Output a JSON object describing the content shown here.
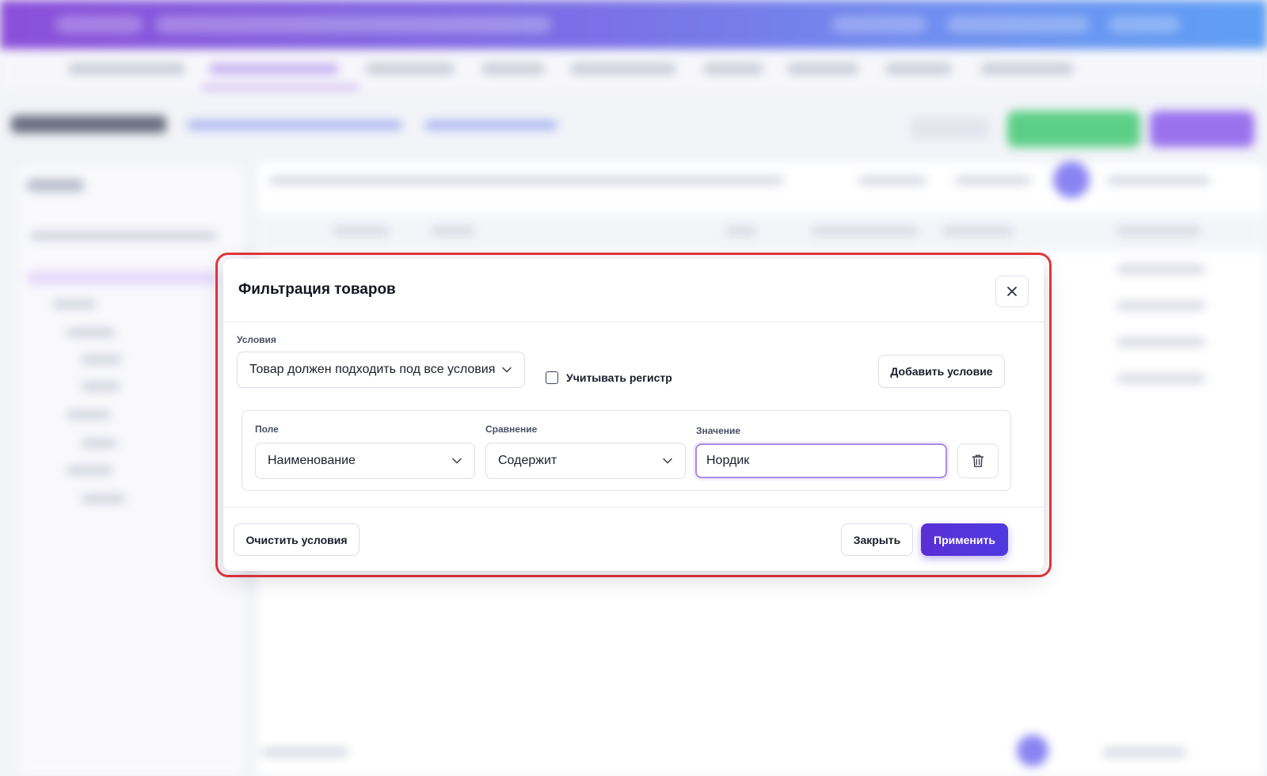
{
  "modal": {
    "title": "Фильтрация товаров",
    "conditions_label": "Условия",
    "match_mode": {
      "selected": "Товар должен подходить под все условия"
    },
    "case_sensitive": {
      "label": "Учитывать регистр",
      "checked": false
    },
    "add_condition_label": "Добавить условие",
    "condition": {
      "field_label": "Поле",
      "field_value": "Наименование",
      "comparison_label": "Сравнение",
      "comparison_value": "Содержит",
      "value_label": "Значение",
      "value": "Нордик"
    },
    "footer": {
      "clear_label": "Очистить условия",
      "close_label": "Закрыть",
      "apply_label": "Применить"
    }
  },
  "icons": {
    "close": "close-icon",
    "chevron": "chevron-down-icon",
    "delete": "trash-icon"
  },
  "colors": {
    "accent": "#5a2fd6",
    "focus_border": "#a88be8",
    "highlight_outline": "#e5373b"
  }
}
